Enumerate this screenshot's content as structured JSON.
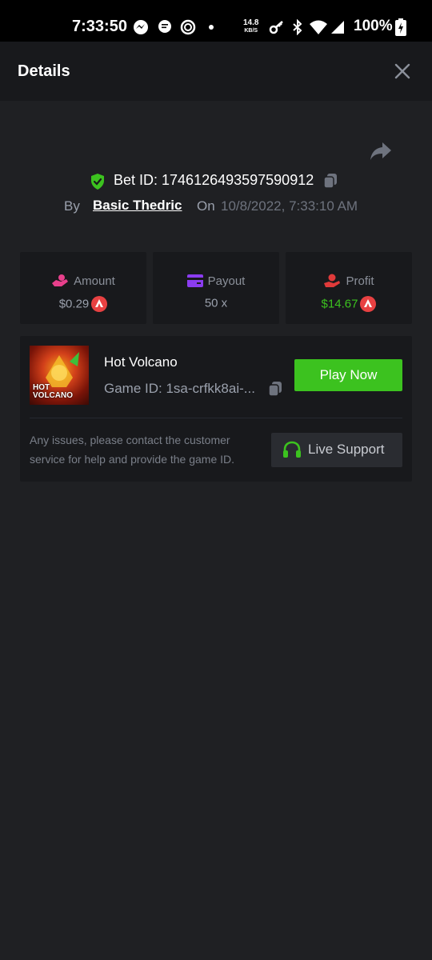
{
  "status_bar": {
    "time": "7:33:50",
    "network_speed": "14.8",
    "network_speed_unit": "KB/S",
    "battery": "100%"
  },
  "header": {
    "title": "Details"
  },
  "bet": {
    "id_label": "Bet ID: 1746126493597590912",
    "by_label": "By",
    "user": "Basic Thedric",
    "on_label": "On",
    "date": "10/8/2022, 7:33:10 AM"
  },
  "stats": {
    "amount": {
      "label": "Amount",
      "value": "$0.29",
      "color": "#9aa0ac"
    },
    "payout": {
      "label": "Payout",
      "value": "50 x",
      "color": "#9aa0ac"
    },
    "profit": {
      "label": "Profit",
      "value": "$14.67",
      "color": "#3cc21f"
    }
  },
  "game": {
    "name": "Hot Volcano",
    "id": "Game ID: 1sa-crfkk8ai-...",
    "thumb_title_1": "HOT",
    "thumb_title_2": "VOLCANO",
    "play_label": "Play Now"
  },
  "support": {
    "text": "Any issues, please contact the customer service for help and provide the game ID.",
    "button_label": "Live Support"
  },
  "colors": {
    "accent_green": "#3cc21f",
    "amount_icon": "#e8408c",
    "payout_icon": "#8b3cf0",
    "profit_icon": "#e03a3a",
    "coin": "#e84142"
  },
  "icons": {
    "close": "close-icon",
    "share": "share-icon",
    "shield": "shield-check-icon",
    "copy": "copy-icon",
    "amount": "money-hand-icon",
    "payout": "credit-card-icon",
    "profit": "profit-hand-icon",
    "coin": "avalanche-coin-icon",
    "support": "headphones-icon"
  }
}
